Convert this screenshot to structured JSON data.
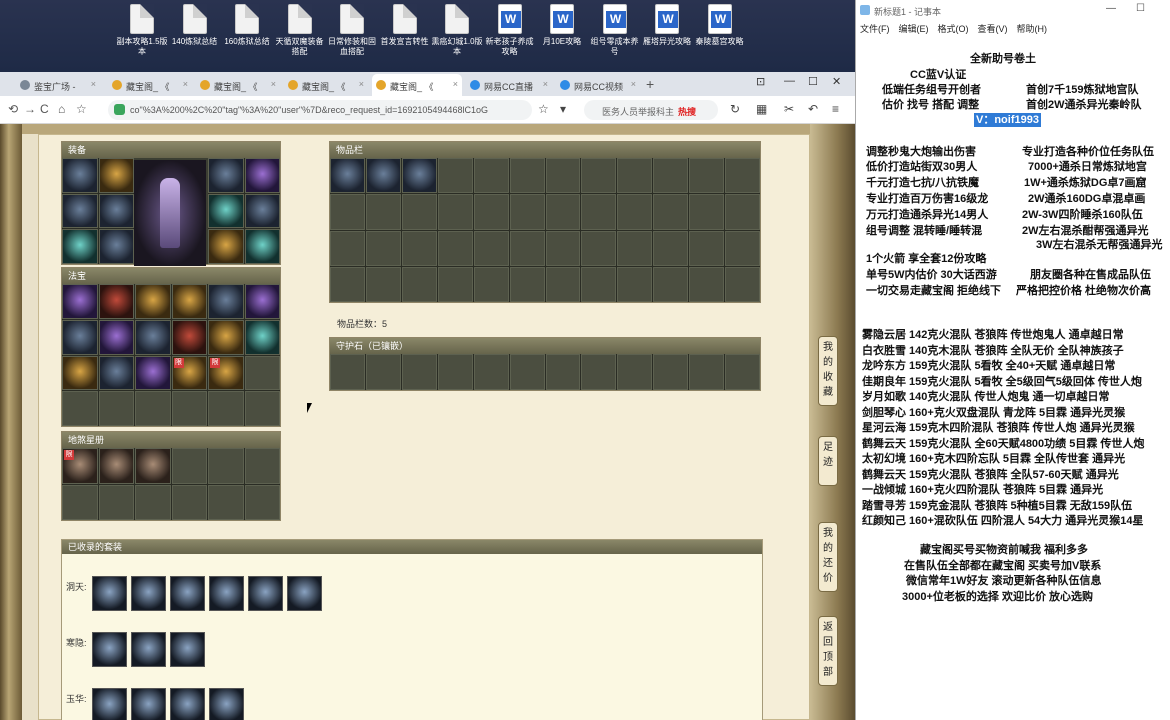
{
  "desktop": {
    "icons": [
      {
        "label": "副本攻略1.5版本",
        "type": "file"
      },
      {
        "label": "140炼狱总结",
        "type": "file"
      },
      {
        "label": "160炼狱总结",
        "type": "file"
      },
      {
        "label": "天循双魔装备搭配",
        "type": "file"
      },
      {
        "label": "日常修装和固血搭配",
        "type": "file"
      },
      {
        "label": "首发宣言转性",
        "type": "file"
      },
      {
        "label": "熏癌幻城1.0版本",
        "type": "file"
      },
      {
        "label": "新老孩子养成攻略",
        "type": "word"
      },
      {
        "label": "月10E攻略",
        "type": "word"
      },
      {
        "label": "组号零成本养号",
        "type": "word"
      },
      {
        "label": "雁塔异光攻略",
        "type": "word"
      },
      {
        "label": "秦陵墓宫攻略",
        "type": "word"
      }
    ]
  },
  "browser": {
    "tabs": [
      {
        "label": "鉴宝广场 -",
        "color": "#7a8796"
      },
      {
        "label": "藏宝阁_ 《",
        "color": "#e4a52a"
      },
      {
        "label": "藏宝阁_ 《",
        "color": "#e4a52a"
      },
      {
        "label": "藏宝阁_ 《",
        "color": "#e4a52a"
      },
      {
        "label": "藏宝阁_ 《",
        "color": "#e4a52a",
        "active": true
      },
      {
        "label": "网易CC直播",
        "color": "#2e8be6"
      },
      {
        "label": "网易CC视频",
        "color": "#2e8be6"
      }
    ],
    "new_tab": "+",
    "window_buttons": {
      "tabs": "⊡",
      "minimize": "—",
      "maximize": "☐",
      "close": "✕"
    },
    "url": "co\"%3A%200%2C%20\"tag\"%3A%20\"user\"%7D&reco_request_id=1692105494468lC1oG",
    "search_placeholder": "医务人员举报科主",
    "search_hot": "热搜",
    "nav": {
      "back": "⟲",
      "forward": "→",
      "reload": "C",
      "home": "⌂",
      "star": "☆"
    }
  },
  "game": {
    "equipment_title": "装备",
    "fabao_title": "法宝",
    "spirit_title": "地煞星册",
    "inventory_title": "物品栏",
    "inventory_count": "物品栏数：5",
    "guardian_title": "守护石（已镶嵌）",
    "collected_title": "已收录的套装",
    "set_rows": [
      "洞天:",
      "寒隐:",
      "玉华:"
    ],
    "side_buttons": [
      "我的收藏",
      "足迹",
      "我的还价",
      "返回顶部"
    ]
  },
  "notepad": {
    "title": "新标题1 - 记事本",
    "menu": [
      "文件(F)",
      "编辑(E)",
      "格式(O)",
      "查看(V)",
      "帮助(H)"
    ],
    "window_buttons": {
      "minimize": "—",
      "maximize": "☐"
    },
    "header_lines": [
      "全新助号卷土",
      "CC蓝V认证",
      "低端任务组号开创者",
      "首创7千159炼狱地宫队",
      "估价 找号 搭配 调整",
      "首创2W通杀异光秦岭队"
    ],
    "contact": "V：noif1993",
    "services_left": [
      "调整秒鬼大炮输出伤害",
      "低价打造站街双30男人",
      "千元打造七抗/八抗铁魔",
      "专业打造百万伤害16级龙",
      "万元打造通杀异光14男人",
      "组号调整 混转睡/睡转混"
    ],
    "services_right": [
      "专业打造各种价位任务队伍",
      "7000+通杀日常炼狱地宫",
      "1W+通杀炼狱DG卓7画窟",
      "2W通杀160DG卓混卓画",
      "2W-3W四阶睡杀160队伍",
      "2W左右混杀酣帮强通异光",
      "3W左右混杀无帮强通异光"
    ],
    "promo_lines": [
      "1个火箭 享全套12份攻略",
      "单号5W内估价 30大话西游",
      "朋友圈各种在售成品队伍",
      "一切交易走藏宝阁 拒绝线下",
      "严格把控价格 杜绝物次价高"
    ],
    "listings": [
      "雾隐云居 142克火混队 苍狼阵 传世炮鬼人 通卓越日常",
      "白衣胜雪 140克木混队 苍狼阵 全队无价 全队神族孩子",
      "龙吟东方 159克火混队 5看牧 全40+天赋 通卓越日常",
      "佳期良年 159克火混队 5看牧 全5级回气5级回体 传世人炮",
      "岁月如歌 140克火混队 传世人炮鬼 通一切卓越日常",
      "剑胆琴心 160+克火双盘混队 青龙阵 5目霖 通异光灵猴",
      "星河云海 159克木四阶混队 苍狼阵 传世人炮 通异光灵猴",
      "鹤舞云天 159克火混队 全60天赋4800功绩 5目霖 传世人炮",
      "太初幻境 160+克木四阶忘队 5目霖 全队传世套 通异光",
      "鹤舞云天 159克火混队 苍狼阵 全队57-60天赋 通异光",
      "一战倾城 160+克火四阶混队 苍狼阵 5目霖 通异光",
      "踏雪寻芳 159克金混队 苍狼阵 5种植5目霖 无敌159队伍",
      "红颜知己 160+混砍队伍 四阶混人 54大力 通异光灵猴14星"
    ],
    "footer_lines": [
      "藏宝阁买号买物资前喊我 福利多多",
      "在售队伍全部都在藏宝阁 买卖号加V联系",
      "微信常年1W好友 滚动更新各种队伍信息",
      "3000+位老板的选择 欢迎比价 放心选购"
    ]
  }
}
